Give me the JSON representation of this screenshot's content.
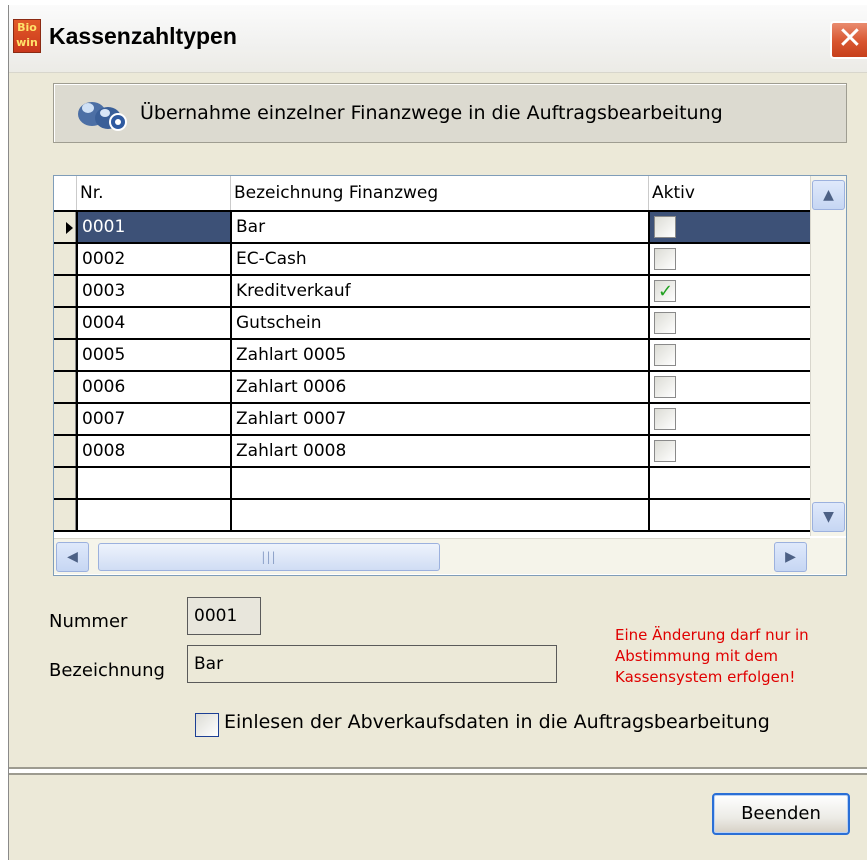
{
  "window": {
    "title": "Kassenzahltypen",
    "app_icon_text": "Bio win",
    "close_symbol": "✕"
  },
  "banner": {
    "icon": "users-gear-icon",
    "text": "Übernahme einzelner Finanzwege in die Auftragsbearbeitung"
  },
  "grid": {
    "columns": [
      "Nr.",
      "Bezeichnung Finanzweg",
      "Aktiv"
    ],
    "rows": [
      {
        "nr": "0001",
        "bezeichnung": "Bar",
        "aktiv": false,
        "selected": true
      },
      {
        "nr": "0002",
        "bezeichnung": "EC-Cash",
        "aktiv": false,
        "selected": false
      },
      {
        "nr": "0003",
        "bezeichnung": "Kreditverkauf",
        "aktiv": true,
        "selected": false
      },
      {
        "nr": "0004",
        "bezeichnung": "Gutschein",
        "aktiv": false,
        "selected": false
      },
      {
        "nr": "0005",
        "bezeichnung": "Zahlart 0005",
        "aktiv": false,
        "selected": false
      },
      {
        "nr": "0006",
        "bezeichnung": "Zahlart 0006",
        "aktiv": false,
        "selected": false
      },
      {
        "nr": "0007",
        "bezeichnung": "Zahlart 0007",
        "aktiv": false,
        "selected": false
      },
      {
        "nr": "0008",
        "bezeichnung": "Zahlart 0008",
        "aktiv": false,
        "selected": false
      }
    ],
    "empty_rows": 2,
    "hscroll_grip": "|||"
  },
  "form": {
    "nummer_label": "Nummer",
    "nummer_value": "0001",
    "bezeichnung_label": "Bezeichnung",
    "bezeichnung_value": "Bar",
    "warning_text": "Eine Änderung darf nur in Abstimmung mit dem Kassensystem erfolgen!",
    "import_checkbox_label": "Einlesen der Abverkaufsdaten in die Auftragsbearbeitung",
    "import_checkbox_checked": false
  },
  "footer": {
    "beenden_label": "Beenden"
  },
  "colors": {
    "selection": "#3d5177",
    "warning": "#e00000",
    "dialog_bg": "#ece9d8"
  }
}
